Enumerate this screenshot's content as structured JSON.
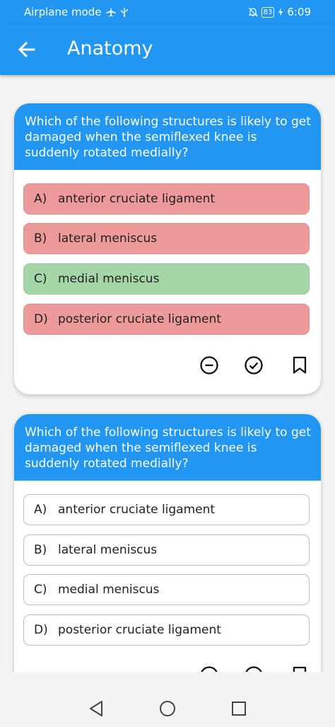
{
  "status": {
    "left_text": "Airplane mode",
    "battery": "83",
    "time": "6:09"
  },
  "appbar": {
    "title": "Anatomy"
  },
  "cards": [
    {
      "question": "Which of the following structures is likely to get damaged when the semiflexed knee is suddenly rotated medially?",
      "options": [
        {
          "letter": "A)",
          "text": "anterior cruciate ligament",
          "state": "wrong"
        },
        {
          "letter": "B)",
          "text": "lateral meniscus",
          "state": "wrong"
        },
        {
          "letter": "C)",
          "text": "medial meniscus",
          "state": "correct"
        },
        {
          "letter": "D)",
          "text": "posterior cruciate ligament",
          "state": "wrong"
        }
      ],
      "actions": [
        "minus-circle-icon",
        "check-circle-icon",
        "bookmark-icon"
      ]
    },
    {
      "question": "Which of the following structures is likely to get damaged when the semiflexed knee is suddenly rotated medially?",
      "options": [
        {
          "letter": "A)",
          "text": "anterior cruciate ligament",
          "state": "unanswered"
        },
        {
          "letter": "B)",
          "text": "lateral meniscus",
          "state": "unanswered"
        },
        {
          "letter": "C)",
          "text": "medial meniscus",
          "state": "unanswered"
        },
        {
          "letter": "D)",
          "text": "posterior cruciate ligament",
          "state": "unanswered"
        }
      ],
      "actions": [
        "minus-circle-icon",
        "check-circle-icon",
        "bookmark-icon"
      ]
    }
  ],
  "colors": {
    "primary": "#2196f3",
    "wrong": "#ef9a9a",
    "correct": "#a5d6a7"
  },
  "navbar": [
    "back-triangle-icon",
    "home-circle-icon",
    "recents-square-icon"
  ]
}
